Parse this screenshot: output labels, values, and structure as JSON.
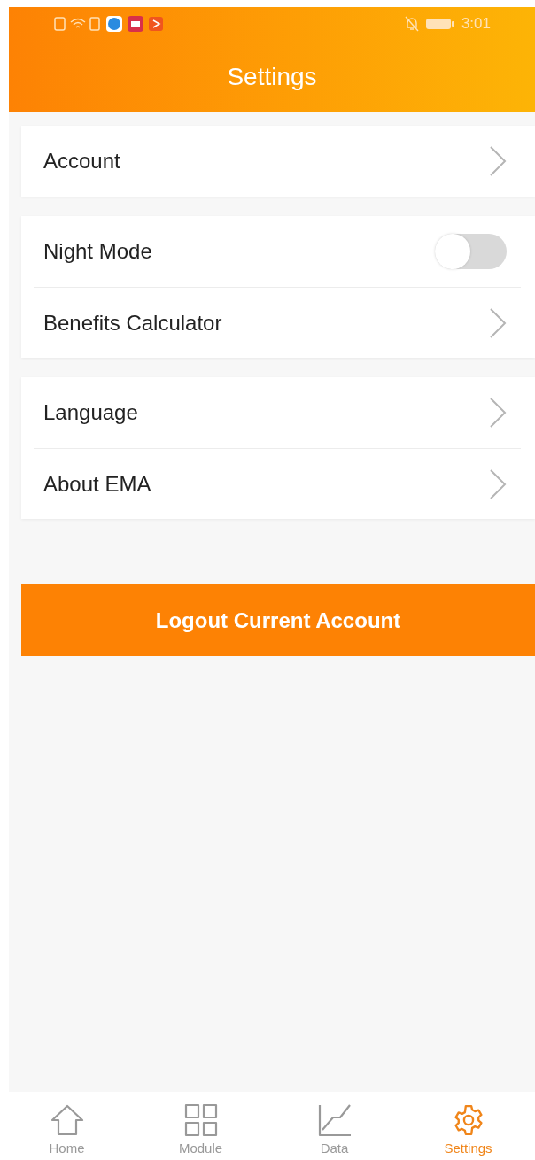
{
  "status_bar": {
    "time": "3:01"
  },
  "header": {
    "title": "Settings"
  },
  "groups": [
    {
      "items": [
        {
          "kind": "link",
          "label": "Account"
        }
      ]
    },
    {
      "items": [
        {
          "kind": "toggle",
          "label": "Night Mode",
          "on": false
        },
        {
          "kind": "link",
          "label": "Benefits Calculator"
        }
      ]
    },
    {
      "items": [
        {
          "kind": "link",
          "label": "Language"
        },
        {
          "kind": "link",
          "label": "About EMA"
        }
      ]
    }
  ],
  "logout_button": {
    "label": "Logout Current Account"
  },
  "tab_bar": [
    {
      "kind": "home",
      "label": "Home",
      "selected": false
    },
    {
      "kind": "module",
      "label": "Module",
      "selected": false
    },
    {
      "kind": "data",
      "label": "Data",
      "selected": false
    },
    {
      "kind": "settings",
      "label": "Settings",
      "selected": true
    }
  ]
}
